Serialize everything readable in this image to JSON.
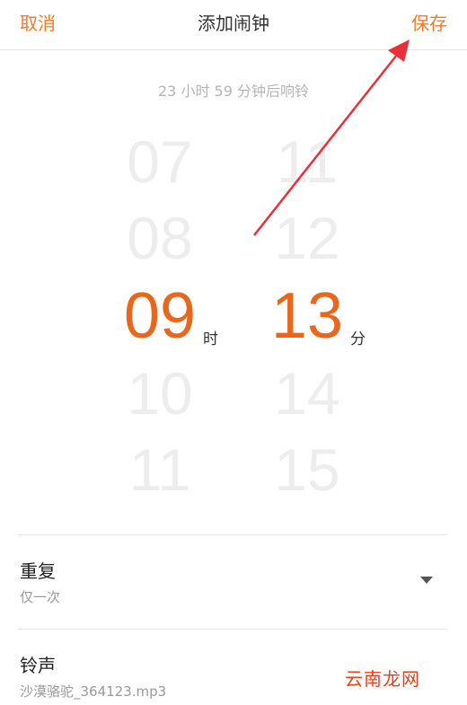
{
  "header": {
    "cancel_label": "取消",
    "title": "添加闹钟",
    "save_label": "保存"
  },
  "countdown_text": "23 小时 59 分钟后响铃",
  "picker": {
    "hours": [
      "07",
      "08",
      "09",
      "10",
      "11"
    ],
    "selected_hour": "09",
    "hour_unit": "时",
    "minutes": [
      "11",
      "12",
      "13",
      "14",
      "15"
    ],
    "selected_minute": "13",
    "minute_unit": "分"
  },
  "repeat": {
    "title": "重复",
    "value": "仅一次"
  },
  "ringtone": {
    "title": "铃声",
    "value": "沙漠骆驼_364123.mp3"
  },
  "watermark": "云南龙网",
  "colors": {
    "accent": "#e8671d",
    "header_button": "#ef7b2e",
    "annotation_arrow": "#e8303a",
    "inactive_number": "#ededed"
  }
}
